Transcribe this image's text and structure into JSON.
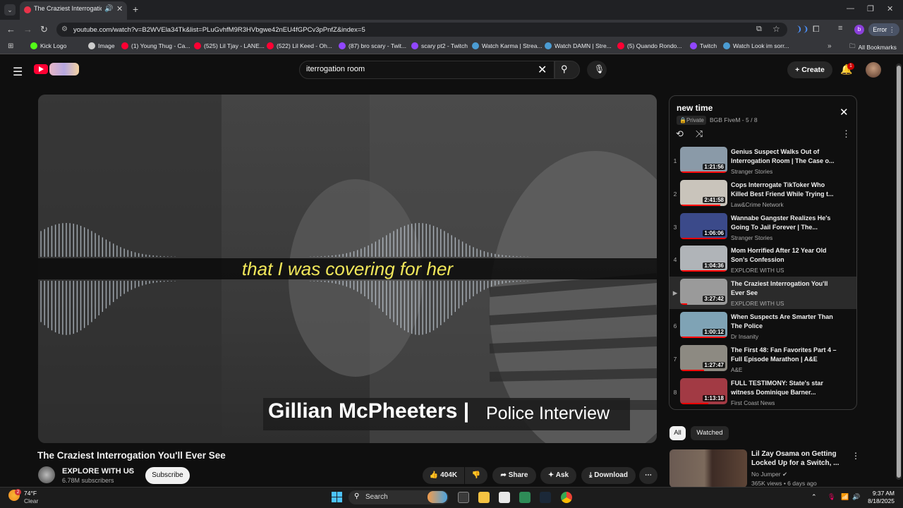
{
  "browser": {
    "tab_title": "The Craziest Interrogation Y",
    "url": "youtube.com/watch?v=B2WVEla34Tk&list=PLuGvhfM9R3HVbgwe42nEU4fGPCv3pPnfZ&index=5",
    "profile_initial": "b",
    "error_label": "Error",
    "bookmarks": [
      {
        "label": "Kick Logo",
        "color": "#53fc18"
      },
      {
        "label": "Image",
        "color": "#cccccc"
      },
      {
        "label": "(1) Young Thug - Ca...",
        "color": "#ff0033"
      },
      {
        "label": "(525) Lil Tjay - LANE...",
        "color": "#ff0033"
      },
      {
        "label": "(522) Lil Keed - Oh...",
        "color": "#ff0033"
      },
      {
        "label": "(87) bro scary - Twit...",
        "color": "#9146ff"
      },
      {
        "label": "scary pt2 - Twitch",
        "color": "#9146ff"
      },
      {
        "label": "Watch Karma | Strea...",
        "color": "#4b9cd3"
      },
      {
        "label": "Watch DAMN | Stre...",
        "color": "#4b9cd3"
      },
      {
        "label": "(5) Quando Rondo...",
        "color": "#ff0033"
      },
      {
        "label": "Twitch",
        "color": "#9146ff"
      },
      {
        "label": "Watch Look im sorr...",
        "color": "#4b9cd3"
      }
    ],
    "all_bookmarks": "All Bookmarks"
  },
  "header": {
    "search_query": "iterrogation room",
    "create_label": "Create",
    "notif_count": "1"
  },
  "video": {
    "caption": "that I was covering for her",
    "lower_third_name": "Gillian McPheeters |",
    "lower_third_tag": "Police Interview",
    "title": "The Craziest Interrogation You'll Ever See",
    "channel": "EXPLORE WITH US",
    "subscribers": "6.78M subscribers",
    "subscribe_label": "Subscribe",
    "likes": "404K",
    "share_label": "Share",
    "ask_label": "Ask",
    "download_label": "Download"
  },
  "playlist": {
    "title": "new time",
    "privacy": "Private",
    "owner": "BGB FiveM - 5 / 8",
    "items": [
      {
        "num": "1",
        "title": "Genius Suspect Walks Out of Interrogation Room | The Case o...",
        "channel": "Stranger Stories",
        "duration": "1:21:56",
        "thumb": "#8a9aa8",
        "progress": 1
      },
      {
        "num": "2",
        "title": "Cops Interrogate TikToker Who Killed Best Friend While Trying t...",
        "channel": "Law&Crime Network",
        "duration": "2:41:58",
        "thumb": "#c9c4bb",
        "progress": 0.85
      },
      {
        "num": "3",
        "title": "Wannabe Gangster Realizes He's Going To Jail Forever | The...",
        "channel": "Stranger Stories",
        "duration": "1:06:06",
        "thumb": "#3b4a8a",
        "progress": 1
      },
      {
        "num": "4",
        "title": "Mom Horrified After 12 Year Old Son's Confession",
        "channel": "EXPLORE WITH US",
        "duration": "1:04:36",
        "thumb": "#b0b4b8",
        "progress": 1
      },
      {
        "num": "▶",
        "title": "The Craziest Interrogation You'll Ever See",
        "channel": "EXPLORE WITH US",
        "duration": "3:27:42",
        "thumb": "#9a9a9a",
        "progress": 0.15
      },
      {
        "num": "6",
        "title": "When Suspects Are Smarter Than The Police",
        "channel": "Dr Insanity",
        "duration": "1:00:12",
        "thumb": "#7fa3b5",
        "progress": 1
      },
      {
        "num": "7",
        "title": "The First 48: Fan Favorites Part 4 – Full Episode Marathon | A&E",
        "channel": "A&E",
        "duration": "1:27:47",
        "thumb": "#8d8a82",
        "progress": 0.5
      },
      {
        "num": "8",
        "title": "FULL TESTIMONY: State's star witness Dominique Barner...",
        "channel": "First Coast News",
        "duration": "1:13:18",
        "thumb": "#a23a44",
        "progress": 0.6
      }
    ]
  },
  "chips": {
    "all": "All",
    "watched": "Watched"
  },
  "recommendation": {
    "title": "Lil Zay Osama on Getting Locked Up for a Switch, ...",
    "channel": "No Jumper",
    "meta": "365K views • 6 days ago"
  },
  "taskbar": {
    "temp": "74°F",
    "condition": "Clear",
    "weather_badge": "2",
    "search_label": "Search",
    "time": "9:37 AM",
    "date": "8/18/2025"
  }
}
